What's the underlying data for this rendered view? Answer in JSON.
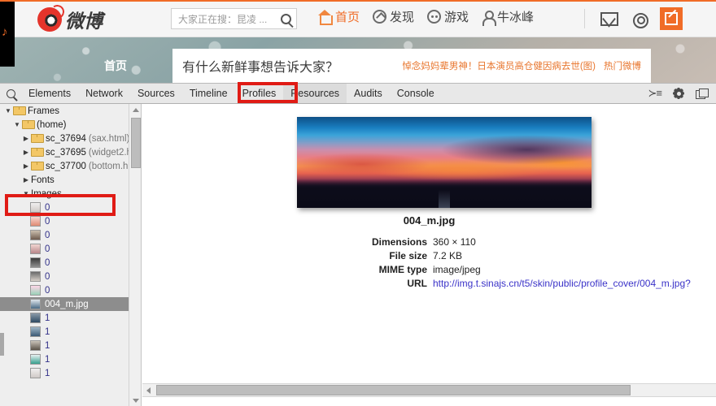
{
  "weibo": {
    "logo_text": "微博",
    "search": {
      "placeholder": "大家正在搜：昆凌 ..."
    },
    "nav": [
      {
        "label": "首页",
        "icon": "home-icon",
        "active": true
      },
      {
        "label": "发现",
        "icon": "compass-icon",
        "active": false
      },
      {
        "label": "游戏",
        "icon": "game-icon",
        "active": false
      },
      {
        "label": "牛冰峰",
        "icon": "user-icon",
        "active": false
      }
    ],
    "actions": [
      {
        "name": "mail-icon",
        "label": ""
      },
      {
        "name": "settings-icon",
        "label": ""
      },
      {
        "name": "compose-icon",
        "label": ""
      }
    ],
    "cover_label": "首页",
    "composer_prompt": "有什么新鲜事想告诉大家？",
    "trend_text": "悼念妈妈辈男神！日本演员高仓健因病去世(图)",
    "trend_link": "热门微博"
  },
  "devtools": {
    "tabs": [
      {
        "label": "Elements",
        "active": false
      },
      {
        "label": "Network",
        "active": false
      },
      {
        "label": "Sources",
        "active": false
      },
      {
        "label": "Timeline",
        "active": false
      },
      {
        "label": "Profiles",
        "active": false
      },
      {
        "label": "Resources",
        "active": true
      },
      {
        "label": "Audits",
        "active": false
      },
      {
        "label": "Console",
        "active": false
      }
    ],
    "toolbar_icons": [
      "inspect-icon",
      "drawer-toggle-icon",
      "settings-gear-icon",
      "dock-mode-icon"
    ],
    "tree": [
      {
        "type": "folder",
        "indent": 0,
        "twisty": "▼",
        "name": "Frames",
        "sub": ""
      },
      {
        "type": "folder",
        "indent": 1,
        "twisty": "▼",
        "name": "(home)",
        "sub": ""
      },
      {
        "type": "folder",
        "indent": 2,
        "twisty": "▶",
        "name": "sc_37694",
        "sub": "(sax.html)"
      },
      {
        "type": "folder",
        "indent": 2,
        "twisty": "▶",
        "name": "sc_37695",
        "sub": "(widget2.h..."
      },
      {
        "type": "folder",
        "indent": 2,
        "twisty": "▶",
        "name": "sc_37700",
        "sub": "(bottom.h..."
      },
      {
        "type": "group",
        "indent": 2,
        "twisty": "▶",
        "name": "Fonts",
        "sub": ""
      },
      {
        "type": "group",
        "indent": 2,
        "twisty": "▼",
        "name": "Images",
        "sub": ""
      },
      {
        "type": "image",
        "indent": 3,
        "name": "0",
        "selected": false
      },
      {
        "type": "image",
        "indent": 3,
        "name": "0",
        "selected": false
      },
      {
        "type": "image",
        "indent": 3,
        "name": "0",
        "selected": false
      },
      {
        "type": "image",
        "indent": 3,
        "name": "0",
        "selected": false
      },
      {
        "type": "image",
        "indent": 3,
        "name": "0",
        "selected": false
      },
      {
        "type": "image",
        "indent": 3,
        "name": "0",
        "selected": false
      },
      {
        "type": "image",
        "indent": 3,
        "name": "0",
        "selected": false
      },
      {
        "type": "image",
        "indent": 3,
        "name": "004_m.jpg",
        "selected": true
      },
      {
        "type": "image",
        "indent": 3,
        "name": "1",
        "selected": false
      },
      {
        "type": "image",
        "indent": 3,
        "name": "1",
        "selected": false
      },
      {
        "type": "image",
        "indent": 3,
        "name": "1",
        "selected": false
      },
      {
        "type": "image",
        "indent": 3,
        "name": "1",
        "selected": false
      },
      {
        "type": "image",
        "indent": 3,
        "name": "1",
        "selected": false
      }
    ],
    "resource": {
      "title": "004_m.jpg",
      "rows": [
        {
          "key": "Dimensions",
          "value": "360 × 110",
          "is_url": false
        },
        {
          "key": "File size",
          "value": "7.2 KB",
          "is_url": false
        },
        {
          "key": "MIME type",
          "value": "image/jpeg",
          "is_url": false
        },
        {
          "key": "URL",
          "value": "http://img.t.sinajs.cn/t5/skin/public/profile_cover/004_m.jpg?",
          "is_url": true
        }
      ]
    }
  },
  "annotations": {
    "color": "#e01b15",
    "boxes": [
      {
        "target": "resources-tab"
      },
      {
        "target": "images-tree-node"
      }
    ]
  }
}
